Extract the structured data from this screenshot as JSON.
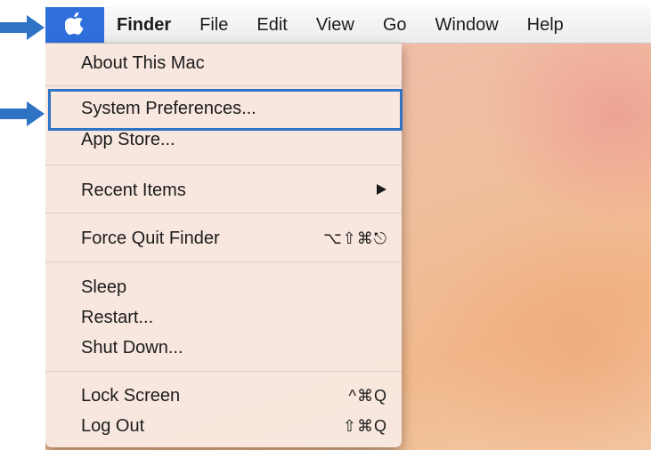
{
  "menubar": {
    "apple_icon": "apple-logo-icon",
    "items": [
      "Finder",
      "File",
      "Edit",
      "View",
      "Go",
      "Window",
      "Help"
    ]
  },
  "apple_menu": {
    "about": "About This Mac",
    "system_preferences": "System Preferences...",
    "app_store": "App Store...",
    "recent_items": "Recent Items",
    "recent_items_icon": "submenu-triangle-icon",
    "force_quit": "Force Quit Finder",
    "force_quit_shortcut": "⌥⇧⌘⎋",
    "sleep": "Sleep",
    "restart": "Restart...",
    "shut_down": "Shut Down...",
    "lock_screen": "Lock Screen",
    "lock_screen_shortcut": "^⌘Q",
    "log_out": "Log Out",
    "log_out_shortcut": "⇧⌘Q"
  },
  "annotation_color": "#2f73c4",
  "highlight_color": "#2f6fdc"
}
